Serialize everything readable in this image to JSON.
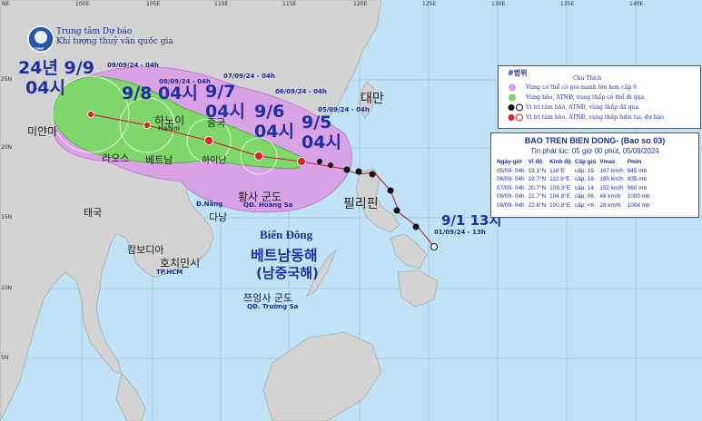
{
  "agency": {
    "line1": "Trung tâm Dự báo",
    "line2": "Khí tượng thuỷ văn quốc gia",
    "badge": "NCHMF"
  },
  "axes": {
    "lon_ticks": [
      "NE",
      "100E",
      "105E",
      "110E",
      "115E",
      "120E",
      "125E",
      "130E",
      "135E",
      "140E"
    ],
    "lat_ticks": [
      "25N",
      "20N",
      "15N",
      "10N",
      "5N"
    ]
  },
  "countries": {
    "myanmar": "미얀마",
    "laos": "라오스",
    "vietnam": "베트남",
    "thailand": "태국",
    "cambodia": "캄보디아",
    "china": "중국",
    "taiwan": "대만",
    "philippines": "필리핀",
    "hanoi": "하노이",
    "hanoi_vn": "HaNoi",
    "hainan": "하이난",
    "danang_vn": "Đ.Nẵng",
    "danang": "다낭",
    "hcm": "호치민시",
    "hcm_vn": "TP.HCM",
    "hoangsa_kr": "황사 군도",
    "hoangsa_vn": "QĐ. Hoàng Sa",
    "truongsa_kr": "쯔엉사 군도",
    "truongsa_vn": "QĐ. Trường Sa",
    "sea_vn": "Biển Đông",
    "sea_kr1": "베트남동해",
    "sea_kr2": "(남중국해)"
  },
  "track_labels": {
    "d99_line1": "24년 9/9",
    "d99_line2": "04시",
    "d98": "9/8 04시",
    "d97_line1": "9/7",
    "d97_line2": "04시",
    "d96_line1": "9/6",
    "d96_line2": "04시",
    "d95_line1": "9/5",
    "d95_line2": "04시",
    "d91": "9/1 13시",
    "s99": "09/09/24 - 04h",
    "s98": "08/09/24 - 04h",
    "s97": "07/09/24 - 04h",
    "s96": "06/09/24 - 04h",
    "s95": "05/09/24 - 04h",
    "s91": "01/09/24 - 13h"
  },
  "legend": {
    "title": "#범위",
    "subtitle": "Chú Thích",
    "rows": [
      "Vùng có thể có gió mạnh lớn hơn cấp 6",
      "Vùng bão, ATNĐ, vùng thấp có thể đi qua",
      "Vị trí tâm bão, ATNĐ, vùng thấp đã qua",
      "Vị trí tâm bão, ATNĐ, vùng thấp hiện tại, dự báo"
    ]
  },
  "bulletin": {
    "title": "BAO TREN BIEN DONG- (Bao so 03)",
    "issued": "Tin phát lúc: 05 giờ 00 phút, 05/09/2024",
    "headers": [
      "Ngày-giờ",
      "Vĩ độ",
      "Kinh độ",
      "Cấp gió",
      "Vmax",
      "Pmin"
    ],
    "rows": [
      [
        "05/09- 04h",
        "19.1°N",
        "116°E",
        "cấp: 15",
        "167 km/h",
        "945 mb"
      ],
      [
        "06/09- 04h",
        "19.7°N",
        "112.9°E",
        "cấp: 16",
        "185 km/h",
        "935 mb"
      ],
      [
        "07/09- 04h",
        "20.7°N",
        "109.3°E",
        "cấp: 14",
        "152 km/h",
        "960 mb"
      ],
      [
        "08/09- 04h",
        "21.7°N",
        "104.8°E",
        "cấp: 06",
        "46 km/h",
        "1000 mb"
      ],
      [
        "09/09- 04h",
        "22.6°N",
        "100.8°E",
        "cấp: <6",
        "28 km/h",
        "1004 mb"
      ]
    ]
  },
  "colors": {
    "sea": "#bfe3f5",
    "land": "#cfcfcf",
    "wind_zone": "#d9a0e6",
    "cone": "#7fd66a",
    "track": "#c0202a",
    "label_blue": "#1f2fa0"
  }
}
